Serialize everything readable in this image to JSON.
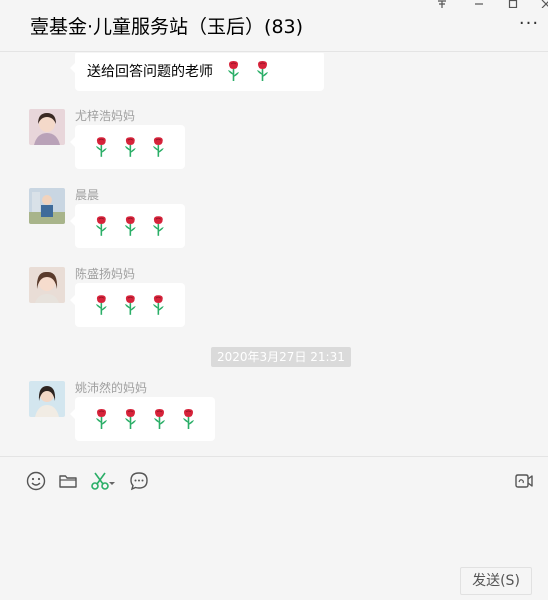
{
  "header": {
    "title": "壹基金·儿童服务站（玉后）(83)",
    "window_controls": [
      "pin-icon",
      "minimize-icon",
      "maximize-icon",
      "close-icon"
    ],
    "more_icon": "more-icon"
  },
  "messages": [
    {
      "sender": "",
      "text": "送给回答问题的老师",
      "roses": 2,
      "avatar_color": "#cccccc"
    },
    {
      "sender": "尤梓浩妈妈",
      "text": "",
      "roses": 3,
      "avatar_color": "#d8c0c4"
    },
    {
      "sender": "晨晨",
      "text": "",
      "roses": 3,
      "avatar_color": "#9ab0c4"
    },
    {
      "sender": "陈盛扬妈妈",
      "text": "",
      "roses": 3,
      "avatar_color": "#c89a86"
    },
    {
      "sender": "姚沛然的妈妈",
      "text": "",
      "roses": 4,
      "avatar_color": "#a9c6d8"
    }
  ],
  "timestamp": "2020年3月27日 21:31",
  "toolbar": {
    "icons": [
      "emoji-icon",
      "folder-icon",
      "scissors-icon",
      "chat-history-icon",
      "video-call-icon"
    ]
  },
  "input": {
    "value": ""
  },
  "send_button": {
    "label": "发送(S)"
  },
  "colors": {
    "accent_green": "#2aae67",
    "rose_red": "#d6233a",
    "bubble": "#ffffff",
    "background": "#f5f5f5"
  }
}
